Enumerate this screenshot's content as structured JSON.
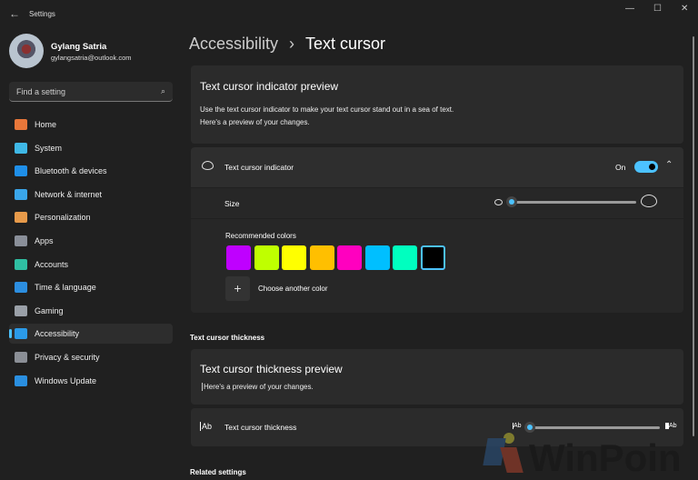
{
  "window": {
    "title": "Settings",
    "back": "←",
    "minimize": "—",
    "maximize": "☐",
    "close": "✕"
  },
  "user": {
    "name": "Gylang Satria",
    "email": "gylangsatria@outlook.com"
  },
  "search": {
    "placeholder": "Find a setting"
  },
  "nav": [
    {
      "label": "Home",
      "color": "#e8773a"
    },
    {
      "label": "System",
      "color": "#3fb8e6"
    },
    {
      "label": "Bluetooth & devices",
      "color": "#1f8fe8"
    },
    {
      "label": "Network & internet",
      "color": "#3aa6ea"
    },
    {
      "label": "Personalization",
      "color": "#e79a4a"
    },
    {
      "label": "Apps",
      "color": "#8a8f99"
    },
    {
      "label": "Accounts",
      "color": "#2fbfa2"
    },
    {
      "label": "Time & language",
      "color": "#2c8ee0"
    },
    {
      "label": "Gaming",
      "color": "#9aa0a8"
    },
    {
      "label": "Accessibility",
      "color": "#2b9ae8"
    },
    {
      "label": "Privacy & security",
      "color": "#8b8f96"
    },
    {
      "label": "Windows Update",
      "color": "#2a8fe0"
    }
  ],
  "breadcrumb": {
    "parent": "Accessibility",
    "sep": "›",
    "current": "Text cursor"
  },
  "indicator_preview": {
    "title": "Text cursor indicator preview",
    "text": "Use the text cursor indicator to make your text cursor stand out in a sea of text. Here's a preview of your changes."
  },
  "indicator": {
    "label": "Text cursor indicator",
    "state": "On",
    "toggle_on": true,
    "size_label": "Size",
    "size_value": 0.0,
    "colors_label": "Recommended colors",
    "colors": [
      "#bf00ff",
      "#bfff00",
      "#ffff00",
      "#ffbf00",
      "#ff00bf",
      "#00bfff",
      "#00ffbf",
      "#000000"
    ],
    "selected_color": 7,
    "choose_label": "Choose another color"
  },
  "thickness": {
    "section": "Text cursor thickness",
    "preview_title": "Text cursor thickness preview",
    "preview_text": "Here's a preview of your changes.",
    "label": "Text cursor thickness",
    "icon_text": "Ab",
    "value": 0.0
  },
  "related": {
    "title": "Related settings"
  },
  "watermark": "WinPoin"
}
